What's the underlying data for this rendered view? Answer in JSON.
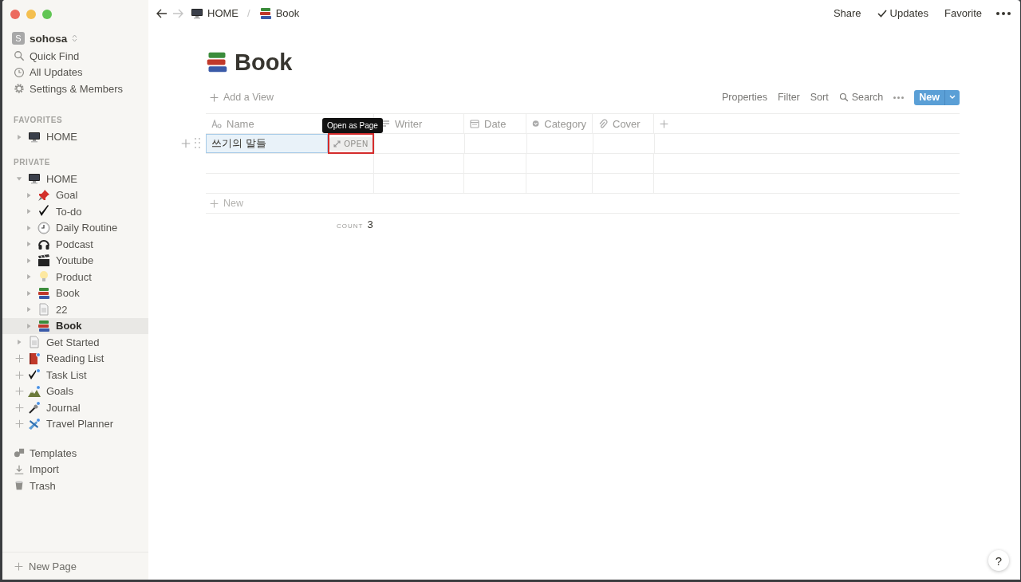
{
  "workspace": {
    "initial": "S",
    "name": "sohosa"
  },
  "nav": [
    {
      "label": "Quick Find"
    },
    {
      "label": "All Updates"
    },
    {
      "label": "Settings & Members"
    }
  ],
  "favorites": {
    "heading": "FAVORITES",
    "items": [
      {
        "label": "HOME",
        "kind": "page",
        "expanded": false,
        "selected": false
      }
    ]
  },
  "private": {
    "heading": "PRIVATE",
    "items": [
      {
        "label": "HOME",
        "kind": "page",
        "expanded": true,
        "selected": false,
        "children": [
          {
            "label": "Goal",
            "kind": "page",
            "expanded": false,
            "selected": false
          },
          {
            "label": "To-do",
            "kind": "page",
            "expanded": false,
            "selected": false
          },
          {
            "label": "Daily Routine",
            "kind": "page",
            "expanded": false,
            "selected": false
          },
          {
            "label": "Podcast",
            "kind": "page",
            "expanded": false,
            "selected": false
          },
          {
            "label": "Youtube",
            "kind": "page",
            "expanded": false,
            "selected": false
          },
          {
            "label": "Product",
            "kind": "page",
            "expanded": false,
            "selected": false
          },
          {
            "label": "Book",
            "kind": "page",
            "expanded": false,
            "selected": false
          },
          {
            "label": "22",
            "kind": "page",
            "expanded": false,
            "selected": false
          },
          {
            "label": "Book",
            "kind": "page",
            "expanded": false,
            "selected": true
          }
        ]
      },
      {
        "label": "Get Started",
        "kind": "page",
        "expanded": false,
        "selected": false
      },
      {
        "label": "Reading List",
        "kind": "template",
        "selected": false
      },
      {
        "label": "Task List",
        "kind": "template",
        "selected": false
      },
      {
        "label": "Goals",
        "kind": "template",
        "selected": false
      },
      {
        "label": "Journal",
        "kind": "template",
        "selected": false
      },
      {
        "label": "Travel Planner",
        "kind": "template",
        "selected": false
      }
    ]
  },
  "tools": [
    {
      "label": "Templates"
    },
    {
      "label": "Import"
    },
    {
      "label": "Trash"
    }
  ],
  "new_page": "New Page",
  "breadcrumbs": [
    {
      "label": "HOME"
    },
    {
      "label": "Book"
    }
  ],
  "breadcrumb_separator": "/",
  "actions": [
    {
      "label": "Share",
      "kind": "text"
    },
    {
      "label": "Updates",
      "kind": "check"
    },
    {
      "label": "Favorite",
      "kind": "text"
    }
  ],
  "page_title": "Book",
  "view_bar": {
    "add_view": "Add a View",
    "controls": [
      {
        "label": "Properties",
        "kind": "text"
      },
      {
        "label": "Filter",
        "kind": "text"
      },
      {
        "label": "Sort",
        "kind": "text"
      },
      {
        "label": "Search",
        "kind": "search"
      }
    ],
    "new_button": "New"
  },
  "table": {
    "columns": [
      {
        "label": "Name",
        "kind": "title"
      },
      {
        "label": "Writer",
        "kind": "text"
      },
      {
        "label": "Date",
        "kind": "date"
      },
      {
        "label": "Category",
        "kind": "select"
      },
      {
        "label": "Cover",
        "kind": "file"
      }
    ],
    "rows": [
      {
        "name": "쓰기의 말들",
        "selected": true
      },
      {
        "selected": false
      },
      {
        "selected": false
      }
    ],
    "open_button": "OPEN",
    "tooltip": "Open as Page",
    "new_row": "New",
    "count_label": "COUNT",
    "count": "3"
  },
  "help": "?"
}
